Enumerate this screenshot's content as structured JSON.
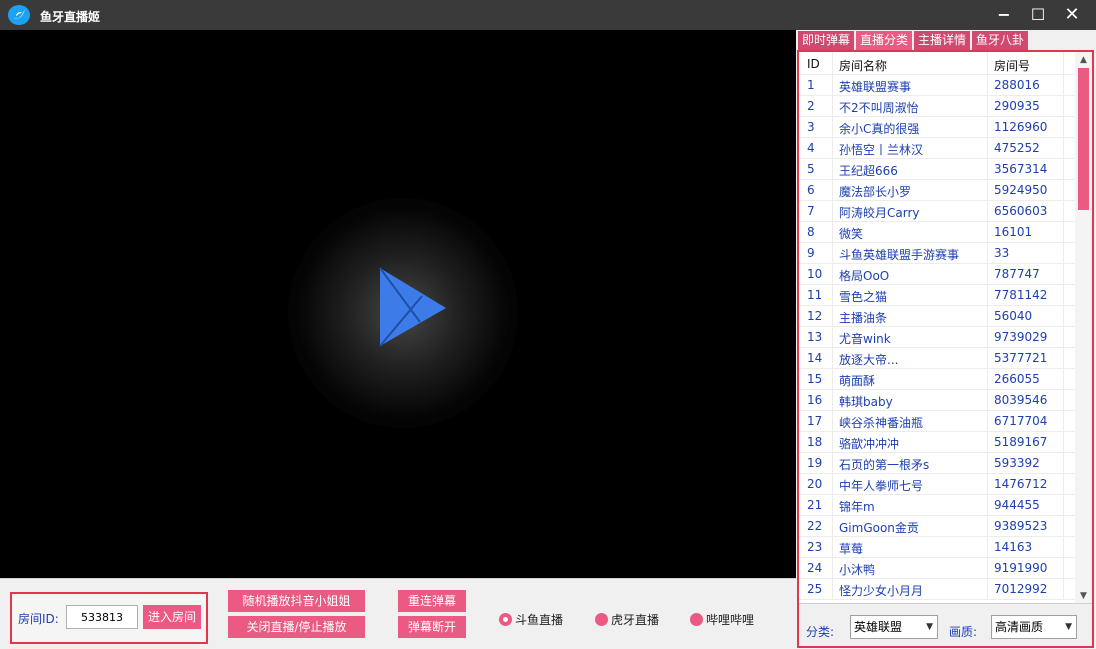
{
  "window": {
    "title": "鱼牙直播姬",
    "minimize": "−",
    "maximize": "☐",
    "close": "✕"
  },
  "room": {
    "label": "房间ID:",
    "id_value": "533813",
    "enter_label": "进入房间"
  },
  "controls": {
    "random_play": "随机播放抖音小姐姐",
    "close_live": "关闭直播/停止播放",
    "reconnect": "重连弹幕",
    "disconnect": "弹幕断开"
  },
  "platforms": [
    {
      "label": "斗鱼直播",
      "selected": true
    },
    {
      "label": "虎牙直播",
      "selected": false
    },
    {
      "label": "哔哩哔哩",
      "selected": false
    }
  ],
  "tabs": [
    {
      "label": "即时弹幕",
      "active": false
    },
    {
      "label": "直播分类",
      "active": true
    },
    {
      "label": "主播详情",
      "active": false
    },
    {
      "label": "鱼牙八卦",
      "active": false
    }
  ],
  "table": {
    "headers": [
      "ID",
      "房间名称",
      "房间号"
    ],
    "rows": [
      [
        "1",
        "英雄联盟赛事",
        "288016"
      ],
      [
        "2",
        "不2不叫周淑怡",
        "290935"
      ],
      [
        "3",
        "余小C真的很强",
        "1126960"
      ],
      [
        "4",
        "孙悟空丨兰林汉",
        "475252"
      ],
      [
        "5",
        "王纪超666",
        "3567314"
      ],
      [
        "6",
        "魔法部长小罗",
        "5924950"
      ],
      [
        "7",
        "阿涛皎月Carry",
        "6560603"
      ],
      [
        "8",
        "微笑",
        "16101"
      ],
      [
        "9",
        "斗鱼英雄联盟手游赛事",
        "33"
      ],
      [
        "10",
        "格局OoO",
        "787747"
      ],
      [
        "11",
        "雪色之猫",
        "7781142"
      ],
      [
        "12",
        "主播油条",
        "56040"
      ],
      [
        "13",
        "尤音wink",
        "9739029"
      ],
      [
        "14",
        "放逐大帝...",
        "5377721"
      ],
      [
        "15",
        "萌面酥",
        "266055"
      ],
      [
        "16",
        "韩琪baby",
        "8039546"
      ],
      [
        "17",
        "峡谷杀神番油瓶",
        "6717704"
      ],
      [
        "18",
        "骆歆冲冲冲",
        "5189167"
      ],
      [
        "19",
        "石页的第一根矛s",
        "593392"
      ],
      [
        "20",
        "中年人拳师七号",
        "1476712"
      ],
      [
        "21",
        "锦年m",
        "944455"
      ],
      [
        "22",
        "GimGoon金贡",
        "9389523"
      ],
      [
        "23",
        "草莓",
        "14163"
      ],
      [
        "24",
        "小沐鸭",
        "9191990"
      ],
      [
        "25",
        "怪力少女小月月",
        "7012992"
      ]
    ]
  },
  "filters": {
    "category_label": "分类:",
    "category_value": "英雄联盟",
    "quality_label": "画质:",
    "quality_value": "高清画质"
  },
  "colors": {
    "accent": "#ea5a82",
    "frame": "#e0374d",
    "link_text": "#1d3fb0",
    "play_button": "#3d7be8"
  }
}
